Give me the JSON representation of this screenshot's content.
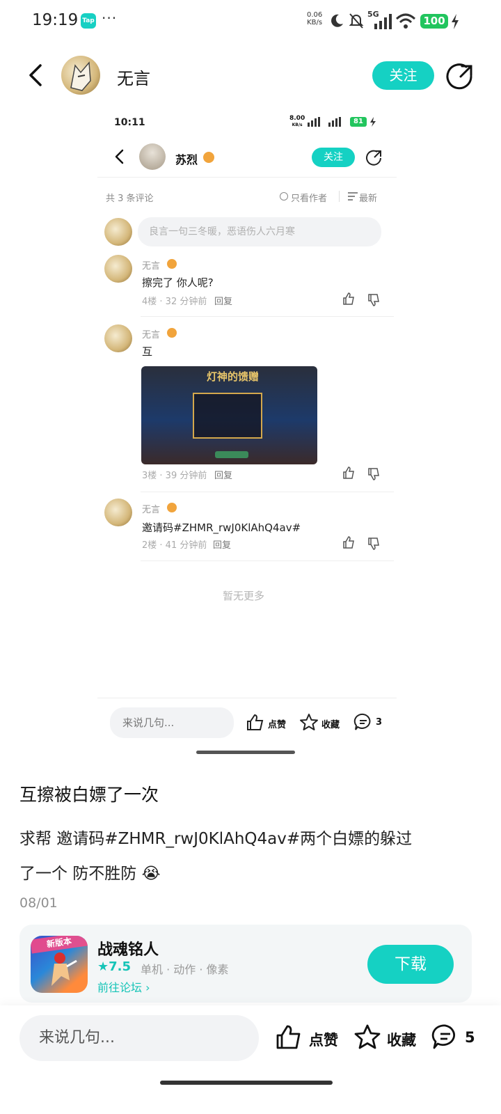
{
  "status_bar": {
    "time": "19:19",
    "app_icon": "Tap",
    "more": "···",
    "net_speed_value": "0.06",
    "net_speed_unit": "KB/s",
    "signal": "5G",
    "battery": "100"
  },
  "header": {
    "author_name": "无言",
    "follow_label": "关注",
    "back_icon": "back-arrow-icon",
    "share_icon": "share-icon"
  },
  "screenshot": {
    "status": {
      "time": "10:11",
      "net_speed_value": "8.00",
      "net_speed_unit": "KB/s",
      "battery": "81"
    },
    "header": {
      "name": "苏烈",
      "follow_label": "关注"
    },
    "comment_count": "共 3 条评论",
    "filter_author": "只看作者",
    "sort_label": "最新",
    "input_placeholder": "良言一句三冬暖，恶语伤人六月寒",
    "comments": [
      {
        "author": "无言",
        "text": "擦完了 你人呢?",
        "meta": "4楼 · 32 分钟前",
        "reply": "回复"
      },
      {
        "author": "无言",
        "text": "互",
        "meta": "3楼 · 39 分钟前",
        "reply": "回复",
        "image_title": "灯神的馈赠"
      },
      {
        "author": "无言",
        "text": "邀请码#ZHMR_rwJ0KlAhQ4av#",
        "meta": "2楼 · 41 分钟前",
        "reply": "回复"
      }
    ],
    "no_more": "暂无更多",
    "bottom": {
      "input": "来说几句...",
      "like": "点赞",
      "fav": "收藏",
      "comments": "3"
    }
  },
  "post": {
    "title": "互擦被白嫖了一次",
    "body_line1": "求帮 邀请码#ZHMR_rwJ0KlAhQ4av#两个白嫖的躲过",
    "body_line2": "了一个 防不胜防",
    "emoji": "😭",
    "date": "08/01"
  },
  "game": {
    "name": "战魂铭人",
    "rating": "7.5",
    "tags": "单机 · 动作 · 像素",
    "forum_link": "前往论坛",
    "badge": "新版本",
    "download_label": "下载"
  },
  "bottom_bar": {
    "input_placeholder": "来说几句...",
    "like_label": "点赞",
    "fav_label": "收藏",
    "comment_count": "5"
  },
  "colors": {
    "accent": "#15d1c3",
    "battery": "#22c55e",
    "text_grey": "#8f8f8f"
  }
}
